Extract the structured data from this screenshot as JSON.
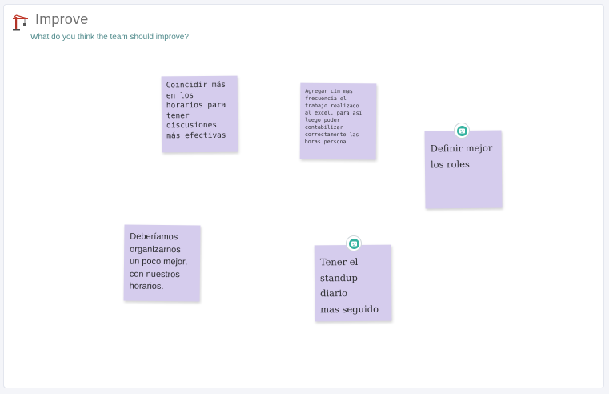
{
  "board": {
    "title": "Improve",
    "subtitle": "What do you think the team should improve?",
    "header_icon": "crane-icon"
  },
  "stickies": [
    {
      "text": "Coincidir más\nen los\nhorarios para\ntener\ndiscusiones\nmás efectivas",
      "has_avatar": false
    },
    {
      "text": "Agregar cin mas\nfrecuencia el\ntrabajo realizado\nal excel, para así\nluego poder\ncontabilizar\ncorrectamente las\nhoras persona",
      "has_avatar": false
    },
    {
      "text": "Definir mejor\nlos roles",
      "has_avatar": true
    },
    {
      "text": "Deberíamos\norganizarnos\nun poco mejor,\ncon nuestros\nhorarios.",
      "has_avatar": false
    },
    {
      "text": "Tener el\nstandup diario\nmas seguido",
      "has_avatar": true
    }
  ],
  "colors": {
    "sticky": "#d5cced",
    "title": "#6f6f6f",
    "subtitle": "#4f8a8b",
    "avatar": "#35b3a0",
    "icon": "#c0392b"
  }
}
